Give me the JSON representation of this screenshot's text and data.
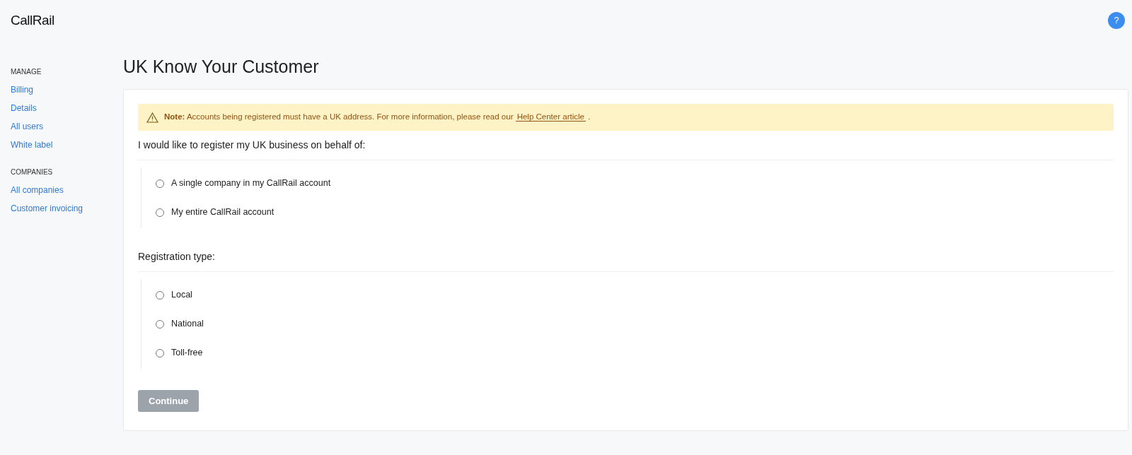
{
  "logo": "**Call**Rail",
  "help_button": "?",
  "sidebar": {
    "sections": [
      {
        "heading": "MANAGE",
        "items": [
          "Billing",
          "Details",
          "All users",
          "White label"
        ]
      },
      {
        "heading": "COMPANIES",
        "items": [
          "All companies",
          "Customer invoicing"
        ]
      }
    ]
  },
  "page_title": "UK Know Your Customer",
  "note": {
    "text": "**Note:** Accounts being registered must have a UK address. For more information, please read our",
    "link": "Help Center article",
    "end": "."
  },
  "questions": [
    {
      "label": "I would like to register my UK business on behalf of:",
      "options": [
        {
          "label": "A single company in my CallRail account",
          "selected": false
        },
        {
          "label": "My entire CallRail account",
          "selected": false
        }
      ]
    },
    {
      "label": "Registration type:",
      "options": [
        {
          "label": "Local",
          "selected": false
        },
        {
          "label": "National",
          "selected": false
        },
        {
          "label": "Toll-free",
          "selected": false
        }
      ]
    }
  ],
  "continue_button": {
    "label": "Continue",
    "disabled": true
  }
}
